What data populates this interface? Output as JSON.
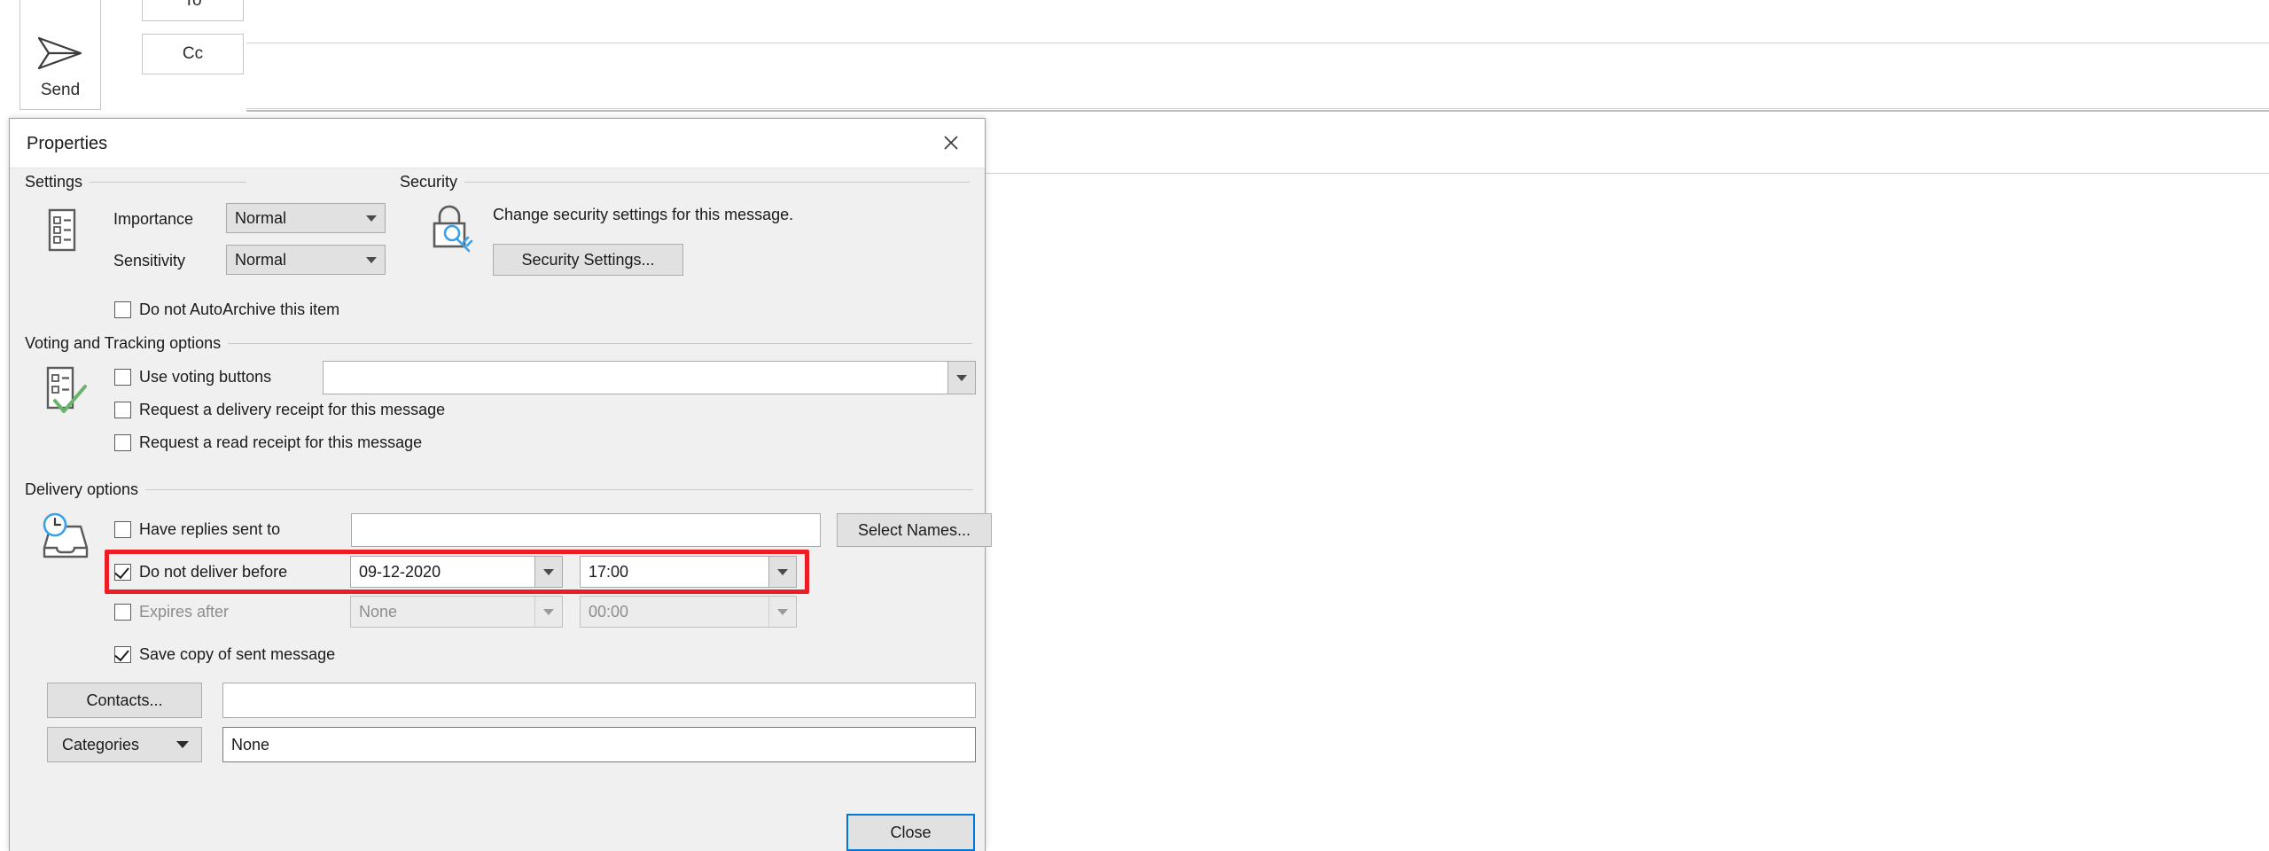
{
  "compose_window": {
    "send_label": "Send",
    "send_icon": "paper-plane-icon",
    "to_label": "To",
    "cc_label": "Cc"
  },
  "dialog": {
    "title": "Properties",
    "close_icon": "close-icon",
    "groups": {
      "settings": {
        "title": "Settings",
        "icon": "message-options-icon",
        "importance_label": "Importance",
        "importance_value": "Normal",
        "sensitivity_label": "Sensitivity",
        "sensitivity_value": "Normal",
        "autoarchive_label": "Do not AutoArchive this item",
        "autoarchive_checked": false
      },
      "security": {
        "title": "Security",
        "icon": "lock-key-icon",
        "description": "Change security settings for this message.",
        "settings_button": "Security Settings..."
      },
      "voting": {
        "title": "Voting and Tracking options",
        "icon": "voting-checklist-icon",
        "use_voting_label": "Use voting buttons",
        "use_voting_checked": false,
        "voting_value": "",
        "delivery_receipt_label": "Request a delivery receipt for this message",
        "delivery_receipt_checked": false,
        "read_receipt_label": "Request a read receipt for this message",
        "read_receipt_checked": false
      },
      "delivery": {
        "title": "Delivery options",
        "icon": "tray-clock-icon",
        "replies_label": "Have replies sent to",
        "replies_checked": false,
        "replies_value": "",
        "select_names_button": "Select Names...",
        "deliver_before_label": "Do not deliver before",
        "deliver_before_checked": true,
        "deliver_before_date": "09-12-2020",
        "deliver_before_time": "17:00",
        "expires_label": "Expires after",
        "expires_checked": false,
        "expires_date": "None",
        "expires_time": "00:00",
        "save_copy_label": "Save copy of sent message",
        "save_copy_checked": true,
        "contacts_button": "Contacts...",
        "contacts_value": "",
        "categories_button": "Categories",
        "categories_value": "None"
      }
    },
    "close_button": "Close"
  },
  "colors": {
    "highlight": "#ee1c25",
    "accent": "#0078d7",
    "dialog_bg": "#f0f0f0"
  }
}
